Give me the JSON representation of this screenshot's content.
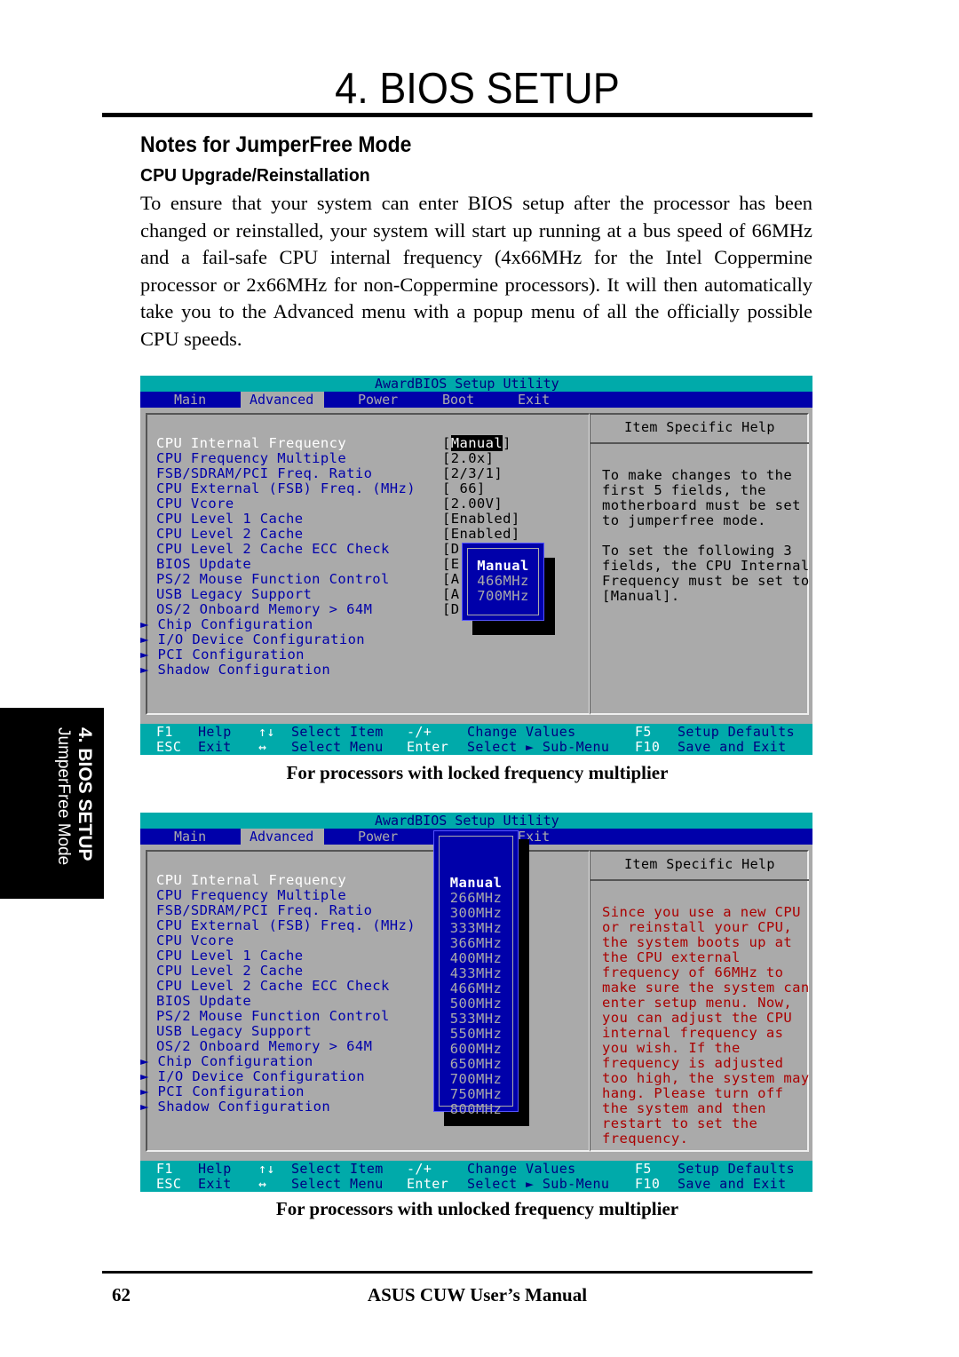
{
  "page": {
    "chapter_title": "4. BIOS SETUP",
    "section_heading": "Notes for JumperFree Mode",
    "subsection_heading": "CPU Upgrade/Reinstallation",
    "body_paragraph": "To ensure that your system can enter BIOS setup after the processor has been changed or reinstalled, your system will start up running at a bus speed of 66MHz and a fail-safe CPU internal frequency (4x66MHz for the Intel Coppermine processor or 2x66MHz for non-Coppermine processors). It will then automatically take you to the Advanced menu with a popup menu of all the officially possible CPU speeds.",
    "side_tab": {
      "chapter": "4. BIOS SETUP",
      "section": "JumperFree Mode"
    },
    "footer": {
      "page_number": "62",
      "manual_title": "ASUS CUW User’s Manual"
    }
  },
  "colors": {
    "bios_cyan": "#00aaaa",
    "bios_blue": "#0000aa",
    "bios_gray": "#aaaaaa",
    "bios_red": "#aa0000"
  },
  "bios_common": {
    "utility_title": "AwardBIOS Setup Utility",
    "menu": [
      "Main",
      "Advanced",
      "Power",
      "Boot",
      "Exit"
    ],
    "active_menu": "Advanced",
    "help_header": "Item Specific Help",
    "items": [
      "CPU Internal Frequency",
      "CPU Frequency Multiple",
      "FSB/SDRAM/PCI Freq. Ratio",
      "CPU External (FSB) Freq. (MHz)",
      "CPU Vcore",
      "CPU Level 1 Cache",
      "CPU Level 2 Cache",
      "CPU Level 2 Cache ECC Check",
      "BIOS Update",
      "PS/2 Mouse Function Control",
      "USB Legacy Support",
      "OS/2 Onboard Memory > 64M",
      "► Chip Configuration",
      "► I/O Device Configuration",
      "► PCI Configuration",
      "► Shadow Configuration"
    ],
    "footer_row1": [
      {
        "key": "F1",
        "label": "Help"
      },
      {
        "key": "↑↓",
        "label": "Select Item"
      },
      {
        "key": "-/+",
        "label": "Change Values"
      },
      {
        "key": "F5",
        "label": "Setup Defaults"
      }
    ],
    "footer_row2": [
      {
        "key": "ESC",
        "label": "Exit"
      },
      {
        "key": "↔",
        "label": "Select Menu"
      },
      {
        "key": "Enter",
        "label": "Select ► Sub-Menu"
      },
      {
        "key": "F10",
        "label": "Save and Exit"
      }
    ]
  },
  "screen1": {
    "caption": "For processors with locked frequency multiplier",
    "values": [
      {
        "text": "[",
        "hl": "Manual",
        "rest": "]"
      },
      {
        "text": "[2.0x]"
      },
      {
        "text": "[2/3/1]"
      },
      {
        "text": "[ 66]"
      },
      {
        "text": "[2.00V]"
      },
      {
        "text": "[Enabled]"
      },
      {
        "text": "[Enabled]"
      },
      {
        "text": "[D"
      },
      {
        "text": "[E"
      },
      {
        "text": "[A"
      },
      {
        "text": "[A"
      },
      {
        "text": "[D"
      }
    ],
    "help_lines": [
      "To make changes to the",
      "first 5 fields, the",
      "motherboard must be set",
      "to jumperfree mode.",
      "",
      "To set the following 3",
      "fields, the CPU Internal",
      "Frequency must be set to",
      "[Manual]."
    ],
    "popup_options": [
      "Manual",
      "466MHz",
      "700MHz"
    ],
    "popup_selected": "Manual"
  },
  "screen2": {
    "caption": "For processors with unlocked frequency multiplier",
    "help_lines": [
      "Since you use a new CPU",
      "or reinstall your CPU,",
      "the system boots up at",
      "the CPU external",
      "frequency of 66MHz to",
      "make sure the system can",
      "enter setup menu. Now,",
      "you can adjust the CPU",
      "internal frequency as",
      "you wish. If the",
      "frequency is adjusted",
      "too high, the system may",
      "hang. Please turn off",
      "the system and then",
      "restart to set the",
      "frequency."
    ],
    "popup_options": [
      "Manual",
      "266MHz",
      "300MHz",
      "333MHz",
      "366MHz",
      "400MHz",
      "433MHz",
      "466MHz",
      "500MHz",
      "533MHz",
      "550MHz",
      "600MHz",
      "650MHz",
      "700MHz",
      "750MHz",
      "800MHz"
    ],
    "popup_selected": "Manual"
  }
}
